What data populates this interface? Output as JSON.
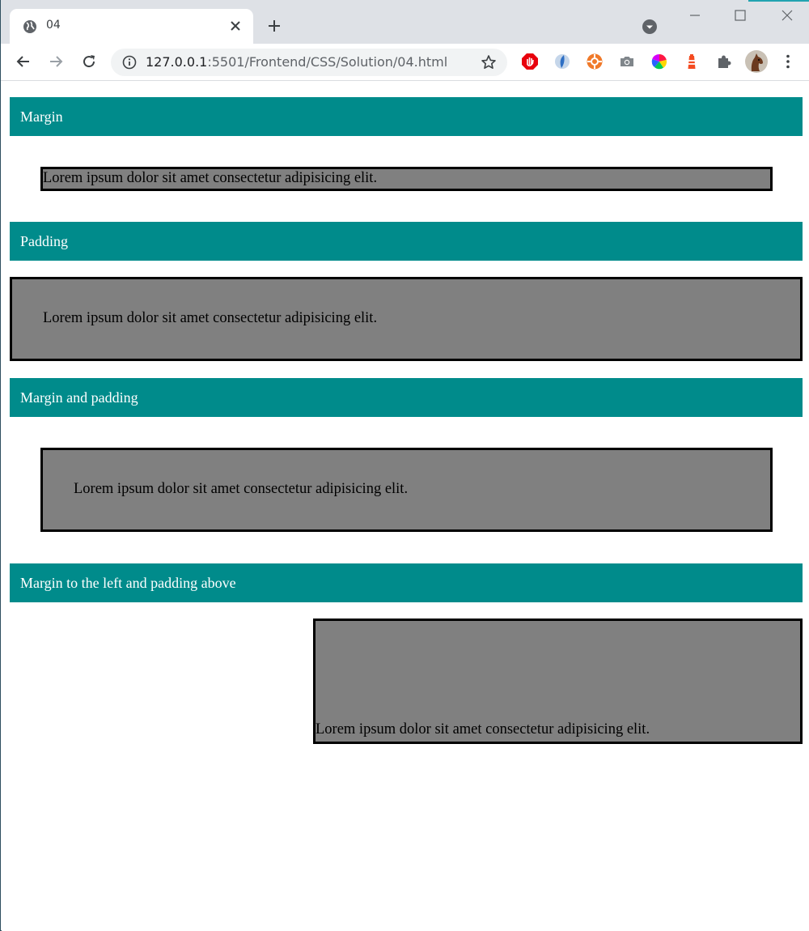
{
  "browser": {
    "tab": {
      "title": "04"
    },
    "address": {
      "host": "127.0.0.1",
      "rest": ":5501/Frontend/CSS/Solution/04.html"
    },
    "colors": {
      "tabstrip": "#dee1e6",
      "omnibox": "#f1f3f4",
      "accent": "#21a3b1"
    },
    "extensions": [
      "adblock-icon",
      "extension-blue-icon",
      "extension-orange-icon",
      "camera-icon",
      "color-wheel-icon",
      "lighthouse-icon",
      "puzzle-icon"
    ]
  },
  "page": {
    "colors": {
      "heading_bg": "#008b8b",
      "box_bg": "#808080",
      "box_border": "#000000"
    },
    "sections": [
      {
        "heading": "Margin",
        "text": "Lorem ipsum dolor sit amet consectetur adipisicing elit."
      },
      {
        "heading": "Padding",
        "text": "Lorem ipsum dolor sit amet consectetur adipisicing elit."
      },
      {
        "heading": "Margin and padding",
        "text": "Lorem ipsum dolor sit amet consectetur adipisicing elit."
      },
      {
        "heading": "Margin to the left and padding above",
        "text": "Lorem ipsum dolor sit amet consectetur adipisicing elit."
      }
    ]
  }
}
